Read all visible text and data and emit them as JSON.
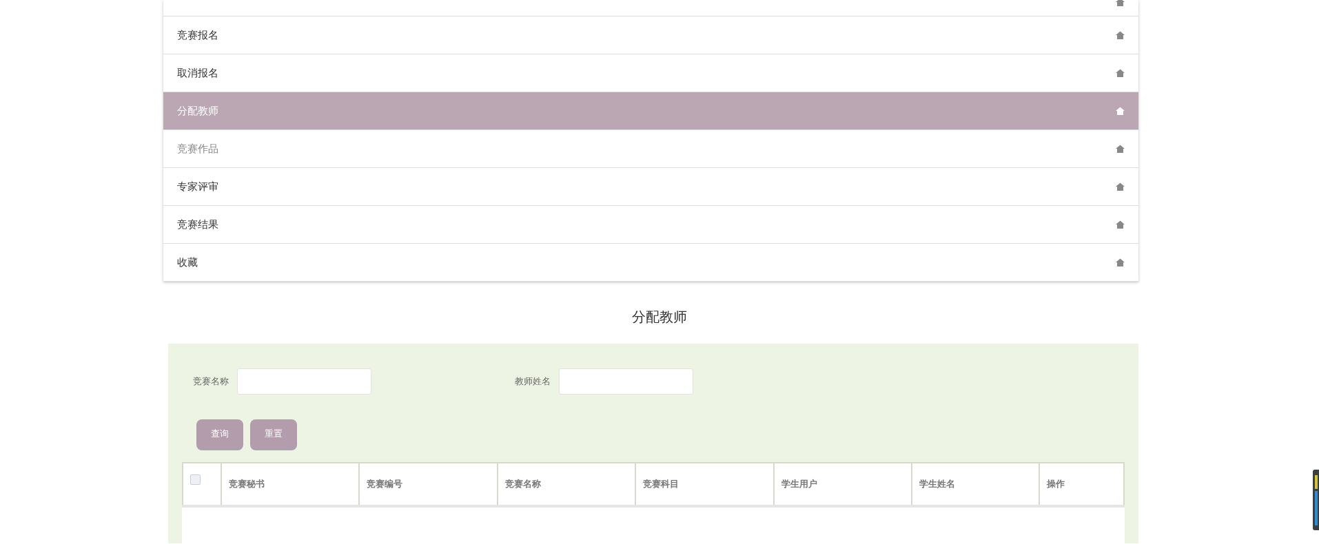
{
  "menu": {
    "items": [
      {
        "label": "竞赛报名",
        "selected": false,
        "hovered": false
      },
      {
        "label": "取消报名",
        "selected": false,
        "hovered": false
      },
      {
        "label": "分配教师",
        "selected": true,
        "hovered": false
      },
      {
        "label": "竞赛作品",
        "selected": false,
        "hovered": true
      },
      {
        "label": "专家评审",
        "selected": false,
        "hovered": false
      },
      {
        "label": "竞赛结果",
        "selected": false,
        "hovered": false
      },
      {
        "label": "收藏",
        "selected": false,
        "hovered": false
      }
    ]
  },
  "page_title": "分配教师",
  "search": {
    "fields": [
      {
        "label": "竞赛名称"
      },
      {
        "label": "教师姓名"
      }
    ],
    "buttons": [
      "查询",
      "重置"
    ]
  },
  "table": {
    "select_all": {
      "checked": false
    },
    "columns": [
      "竞赛秘书",
      "竞赛编号",
      "竞赛名称",
      "竞赛科目",
      "学生用户",
      "学生姓名",
      "操作"
    ]
  }
}
